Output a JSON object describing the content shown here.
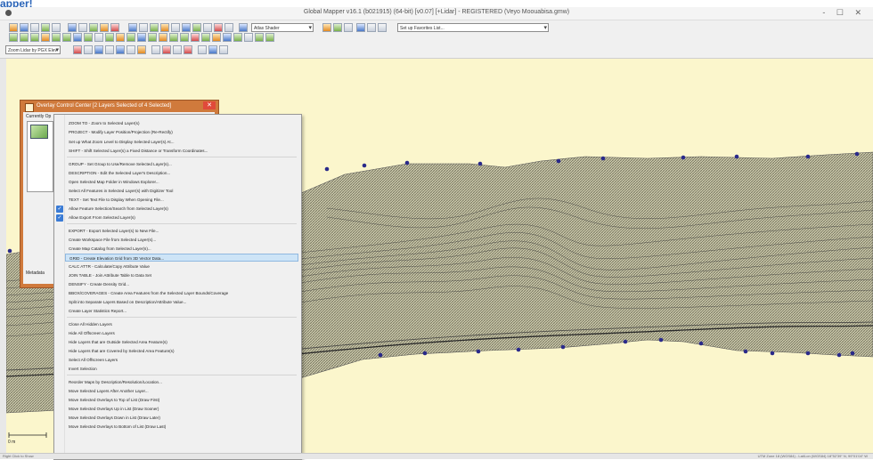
{
  "brand": "apper!",
  "window": {
    "title": "Global Mapper v16.1 (b021915) (64-bit) [v0.07] [+Lidar] - REGISTERED (Veyo Moouabisa.gmw)",
    "controls": "- ☐ ✕"
  },
  "toolbar": {
    "shader_combo": "Atlas Shader",
    "favorites_combo": "Set up Favorites List...",
    "layer_combo": "Zoom Lidar by PGX Elev"
  },
  "dialog": {
    "title": "Overlay Control Center [2 Layers Selected of 4 Selected]",
    "close": "✕",
    "list_label": "Currently Op",
    "metadata_label": "Metadata"
  },
  "menu": {
    "items": [
      {
        "label": "ZOOM TO - Zoom to Selected Layer(s)"
      },
      {
        "label": "PROJECT - Modify Layer Position/Projection (Re-Rectify)"
      },
      {
        "label": "Set up What Zoom Level to Display Selected Layer(s) At..."
      },
      {
        "label": "SHIFT - Shift Selected Layer(s) a Fixed Distance or Transform Coordinates..."
      },
      {
        "label": "GROUP - Set Group to Use/Remove Selected Layer(s)..."
      },
      {
        "label": "DESCRIPTION - Edit the Selected Layer's Description..."
      },
      {
        "label": "Open Selected Map Folder in Windows Explorer..."
      },
      {
        "label": "Select All Features in Selected Layer(s) with Digitizer Tool"
      },
      {
        "label": "TEXT - Set Text File to Display When Opening File..."
      },
      {
        "label": "Allow Feature Selection/Search from Selected Layer(s)"
      },
      {
        "label": "Allow Export From Selected Layer(s)"
      },
      {
        "label": "EXPORT - Export Selected Layer(s) to New File..."
      },
      {
        "label": "Create Workspace File from Selected Layer(s)..."
      },
      {
        "label": "Create Map Catalog from Selected Layer(s)..."
      },
      {
        "label": "GRID - Create Elevation Grid from 3D Vector Data..."
      },
      {
        "label": "CALC ATTR - Calculate/Copy Attribute Value"
      },
      {
        "label": "JOIN TABLE - Join Attribute Table to Data Set"
      },
      {
        "label": "DENSIFY - Create Density Grid..."
      },
      {
        "label": "BBOX/COVERAGES - Create Area Features from the Selected Layer Bounds/Coverage"
      },
      {
        "label": "Split into Separate Layers Based on Description/Attribute Value..."
      },
      {
        "label": "Create Layer Statistics Report..."
      },
      {
        "label": "Close All Hidden Layers"
      },
      {
        "label": "Hide All Offscreen Layers"
      },
      {
        "label": "Hide Layers that are Outside Selected Area Feature(s)"
      },
      {
        "label": "Hide Layers that are Covered by Selected Area Feature(s)"
      },
      {
        "label": "Select All Offscreen Layers"
      },
      {
        "label": "Invert Selection"
      },
      {
        "label": "Reorder Maps by Description/Resolution/Location..."
      },
      {
        "label": "Move Selected Layers After Another Layer..."
      },
      {
        "label": "Move Selected Overlays to Top of List (Draw First)"
      },
      {
        "label": "Move Selected Overlays Up in List (Draw Sooner)"
      },
      {
        "label": "Move Selected Overlays Down in List (Draw Later)"
      },
      {
        "label": "Move Selected Overlays to Bottom of List (Draw Last)"
      }
    ]
  },
  "map": {
    "scale_label": "0 m"
  },
  "status": {
    "left": "Right Click to Show",
    "right": "UTM Zone 18 (WGS84) - Lat/Lon (WGS84) 18°52'39\" N, 99°01'04\" W"
  },
  "colors": {
    "canvas": "#fbf6cc",
    "dialog_title": "#d07a3c",
    "menu_highlight": "#cde4f7",
    "points": "#2a2a8a"
  }
}
